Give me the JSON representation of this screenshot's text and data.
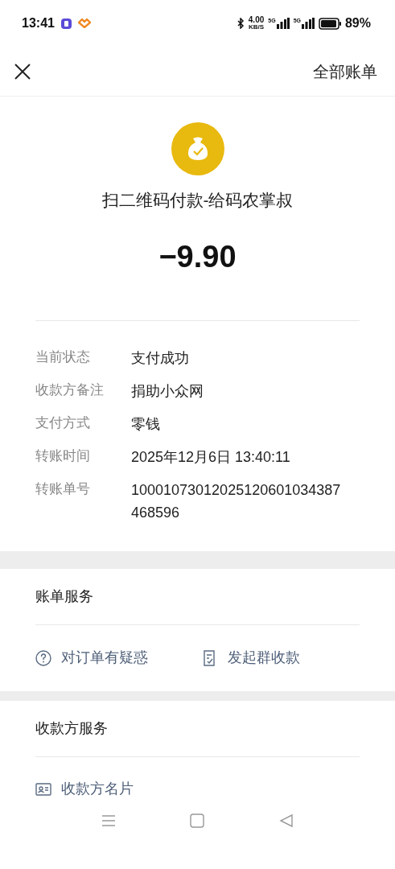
{
  "status_bar": {
    "time": "13:41",
    "net_speed": "4.00",
    "net_unit": "KB/S",
    "sim_1": "5G",
    "sim_2": "5G",
    "battery": "89%"
  },
  "nav": {
    "action": "全部账单"
  },
  "payment": {
    "title": "扫二维码付款-给码农掌叔",
    "amount": "−9.90"
  },
  "details": [
    {
      "label": "当前状态",
      "value": "支付成功"
    },
    {
      "label": "收款方备注",
      "value": "捐助小众网"
    },
    {
      "label": "支付方式",
      "value": "零钱"
    },
    {
      "label": "转账时间",
      "value": "2025年12月6日 13:40:11"
    },
    {
      "label": "转账单号",
      "value": "10001073012025120601034387468596"
    }
  ],
  "sections": [
    {
      "title": "账单服务",
      "items": [
        {
          "kind": "question",
          "label": "对订单有疑惑"
        },
        {
          "kind": "split",
          "label": "发起群收款"
        }
      ]
    },
    {
      "title": "收款方服务",
      "items": [
        {
          "kind": "card",
          "label": "收款方名片"
        }
      ]
    }
  ]
}
